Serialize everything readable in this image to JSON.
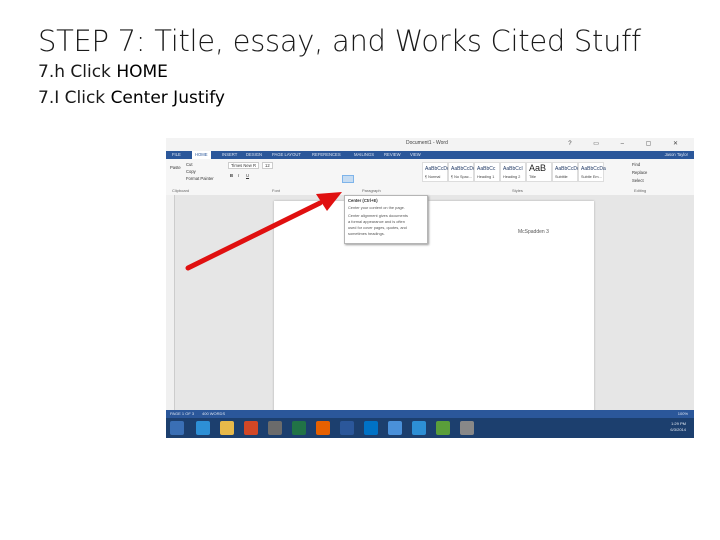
{
  "slide": {
    "title": "STEP 7: Title, essay, and Works Cited Stuff",
    "step_h_prefix": "7.h Click ",
    "step_h_target": "HOME",
    "step_i_prefix": "7.I Click ",
    "step_i_target": "Center Justify"
  },
  "word": {
    "doc_title": "Document1 - Word",
    "window_controls": "? ▭ – ▢ ✕",
    "user": "Jason Taylor",
    "tabs": [
      "FILE",
      "HOME",
      "INSERT",
      "DESIGN",
      "PAGE LAYOUT",
      "REFERENCES",
      "MAILINGS",
      "REVIEW",
      "VIEW"
    ],
    "clipboard": {
      "paste": "Paste",
      "cut": "Cut",
      "copy": "Copy",
      "format_painter": "Format Painter",
      "label": "Clipboard"
    },
    "font": {
      "name": "Times New R",
      "size": "12",
      "label": "Font"
    },
    "paragraph_label": "Paragraph",
    "styles": [
      {
        "sample": "AaBbCcDc",
        "name": "¶ Normal"
      },
      {
        "sample": "AaBbCcDc",
        "name": "¶ No Spac..."
      },
      {
        "sample": "AaBbCc",
        "name": "Heading 1"
      },
      {
        "sample": "AaBbCcI",
        "name": "Heading 2"
      },
      {
        "sample": "AaB",
        "name": "Title"
      },
      {
        "sample": "AaBbCcDc",
        "name": "Subtitle"
      },
      {
        "sample": "AaBbCcDa",
        "name": "Subtle Em..."
      }
    ],
    "styles_label": "Styles",
    "editing": {
      "find": "Find",
      "replace": "Replace",
      "select": "Select",
      "label": "Editing"
    },
    "tooltip": {
      "title": "Center (Ctrl+E)",
      "lines": [
        "Center your content on the page.",
        "Center alignment gives documents",
        "a formal appearance and is often",
        "used for cover pages, quotes, and",
        "sometimes headings."
      ]
    },
    "page_text": "McSpadden 3",
    "status": {
      "page": "PAGE 1 OF 3",
      "words": "400 WORDS",
      "zoom": "100%"
    },
    "taskbar_clock": {
      "time": "1:29 PM",
      "date": "6/3/2014"
    },
    "accent": "#2b579a",
    "arrow_color": "#e01010"
  }
}
